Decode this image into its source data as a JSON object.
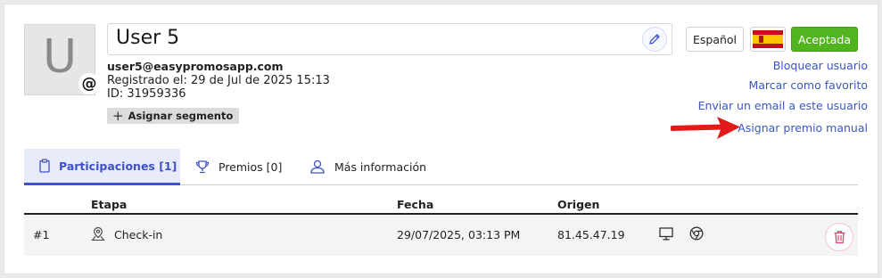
{
  "user": {
    "avatar_letter": "U",
    "at_symbol": "@",
    "name": "User 5",
    "email": "user5@easypromosapp.com",
    "registered": "Registrado el: 29 de Jul de 2025 15:13",
    "id": "ID: 31959336",
    "segment_button": "Asignar segmento"
  },
  "header_actions": {
    "language": "Español",
    "status": "Aceptada",
    "status_color": "#52b520"
  },
  "actions": {
    "block_user": "Bloquear usuario",
    "mark_favorite": "Marcar como favorito",
    "send_email": "Enviar un email a este usuario",
    "assign_prize": "Asignar premio manual"
  },
  "tabs": [
    {
      "label": "Participaciones [1]",
      "icon": "clipboard-icon",
      "active": true
    },
    {
      "label": "Premios [0]",
      "icon": "trophy-icon",
      "active": false
    },
    {
      "label": "Más información",
      "icon": "user-icon",
      "active": false
    }
  ],
  "table": {
    "columns": [
      "Etapa",
      "Fecha",
      "Origen"
    ],
    "rows": [
      {
        "index": "#1",
        "stage": "Check-in",
        "date": "29/07/2025, 03:13 PM",
        "origin": "81.45.47.19",
        "device_icon": "desktop-icon",
        "browser_icon": "chrome-icon"
      }
    ]
  },
  "colors": {
    "accent": "#3f51c8",
    "link": "#3a56c4",
    "arrow": "#e21a1a",
    "delete": "#e0456b"
  }
}
